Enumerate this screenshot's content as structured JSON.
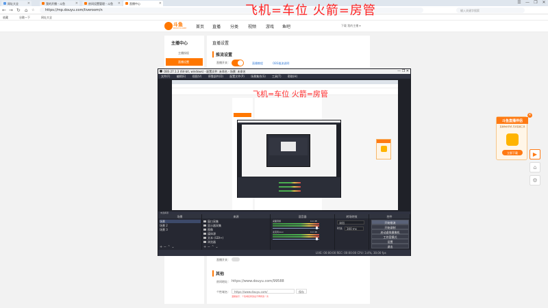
{
  "browser": {
    "tabs": [
      {
        "label": "网址大全"
      },
      {
        "label": "我的开播 - 斗鱼"
      },
      {
        "label": "房间设置管理 - 斗鱼"
      },
      {
        "label": "直播中心"
      }
    ],
    "controls": [
      "☰",
      "—",
      "❐",
      "✕"
    ],
    "url": "https://mp.douyu.com/liveroom/n",
    "search_placeholder": "输入关键字搜索",
    "bookmarks": [
      "收藏",
      "谷歌一下",
      "网址大全"
    ]
  },
  "site": {
    "logo_text": "斗鱼",
    "logo_sub": "DOUYU.COM",
    "nav": [
      "首页",
      "直播",
      "分类",
      "视频",
      "游戏",
      "鱼吧"
    ],
    "nav_badge_new": "NEW",
    "banner_text": "飞机=车位  火箭=房管",
    "user_area": "下载    我的主播 ▾",
    "sidebar_title": "主播中心",
    "sidebar_items": [
      {
        "label": "主播授权"
      },
      {
        "label": "直播设置"
      }
    ],
    "page_title": "直播设置",
    "section_title": "推流设置",
    "switch_label": "直播开关：",
    "link1": "直播教程",
    "link2": "OBS推流说明",
    "section2": "其他",
    "room_url_label": "房间地址：",
    "room_url": "https://www.douyu.com/99588",
    "custom_url_label": "个性域名：",
    "custom_url_value": "https://www.douyu.com/",
    "custom_url_btn": "保存",
    "custom_url_hint": "温馨提示：个性域名修改后不再修改一次",
    "lower_label": "直播开关："
  },
  "ad": {
    "title": "斗鱼直播伴侣",
    "desc": "直播你的手机 高清直播工具",
    "button": "立即下载",
    "close": "×",
    "side_buttons": [
      "▶",
      "⌂",
      "⚙"
    ]
  },
  "obs": {
    "title": "OBS 27.1.3 (64-bit, windows) - 配置文件: 未命名 - 场景: 未命名",
    "title_controls": "—  ❐  ✕",
    "menu": [
      "文件(F)",
      "编辑(E)",
      "视图(V)",
      "停靠部件(D)",
      "配置文件(P)",
      "场景集合(S)",
      "工具(T)",
      "帮助(H)"
    ],
    "nested_banner": "飞机=车位  火箭=房管",
    "dockbar_label": "未选择源",
    "dock_titles": [
      "场景",
      "来源",
      "混音器",
      "转场特效",
      "控件"
    ],
    "scenes": [
      "场景",
      "场景 2",
      "场景 3"
    ],
    "sources": [
      "窗口采集",
      "显示器采集",
      "图像",
      "媒体源",
      "文本 (GDI+)",
      "浏览器"
    ],
    "mixer": [
      {
        "name": "桌面音频",
        "db": "0.0 dB"
      },
      {
        "name": "麦克风/Aux",
        "db": "0.0 dB"
      }
    ],
    "transition": {
      "type": "淡出",
      "duration_label": "时长",
      "duration": "300 ms"
    },
    "controls": [
      "开始推流",
      "开始录制",
      "启动虚拟摄像机",
      "工作室模式",
      "设置",
      "退出"
    ],
    "status": "LIVE: 00:00:00    REC: 00:00:00    CPU: 3.4%, 30.00 fps",
    "dock_foot": "+  −  ⌃  ⌄"
  }
}
